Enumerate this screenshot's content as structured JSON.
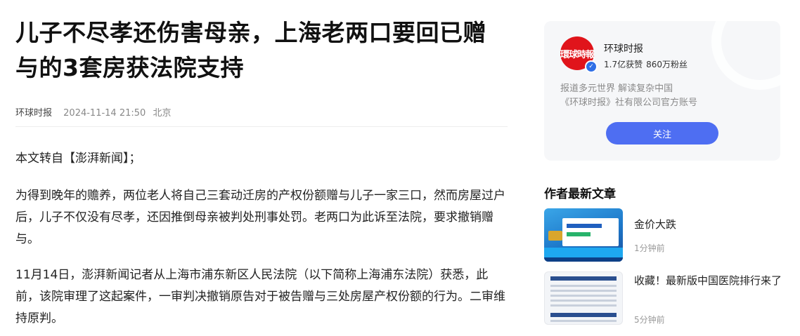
{
  "article": {
    "title": "儿子不尽孝还伤害母亲，上海老两口要回已赠与的3套房获法院支持",
    "source": "环球时报",
    "time": "2024-11-14 21:50",
    "location": "北京",
    "paragraphs": [
      "本文转自【澎湃新闻】；",
      "为得到晚年的赡养，两位老人将自己三套动迁房的产权份额赠与儿子一家三口，然而房屋过户后，儿子不仅没有尽孝，还因推倒母亲被判处刑事处罚。老两口为此诉至法院，要求撤销赠与。",
      "11月14日，澎湃新闻记者从上海市浦东新区人民法院（以下简称上海浦东法院）获悉，此前，该院审理了这起案件，一审判决撤销原告对于被告赠与三处房屋产权份额的行为。二审维持原判。"
    ]
  },
  "author": {
    "name": "环球时报",
    "likes": "1.7亿获赞",
    "fans": "860万粉丝",
    "desc_line1": "报道多元世界 解读复杂中国",
    "desc_line2": "《环球时报》社有限公司官方账号",
    "follow_label": "关注"
  },
  "latest": {
    "title": "作者最新文章",
    "items": [
      {
        "title": "金价大跌",
        "time": "1分钟前"
      },
      {
        "title": "收藏！最新版中国医院排行来了",
        "time": "5分钟前"
      }
    ]
  },
  "colors": {
    "accent": "#4e6ef2",
    "brand_red": "#e0141b",
    "verify_blue": "#2f6fe6"
  },
  "icons": {
    "verify": "verified-badge-icon",
    "avatar": "huanqiu-logo"
  }
}
